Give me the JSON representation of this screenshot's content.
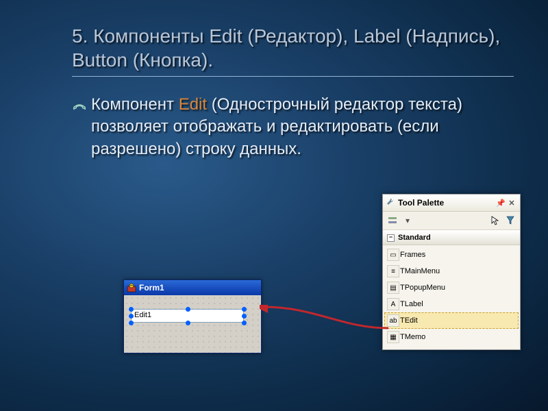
{
  "title": "5. Компоненты Edit (Редактор), Label (Надпись), Button (Кнопка).",
  "body": {
    "before": "Компонент ",
    "accent": "Edit",
    "after": " (Однострочный редактор текста) позволяет отображать и редактировать (если разрешено) строку данных."
  },
  "form": {
    "title": "Form1",
    "edit_value": "Edit1"
  },
  "palette": {
    "title": "Tool Palette",
    "category": "Standard",
    "items": [
      {
        "label": "Frames",
        "icon": "▭"
      },
      {
        "label": "TMainMenu",
        "icon": "≡"
      },
      {
        "label": "TPopupMenu",
        "icon": "▤"
      },
      {
        "label": "TLabel",
        "icon": "A"
      },
      {
        "label": "TEdit",
        "icon": "ab",
        "selected": true
      },
      {
        "label": "TMemo",
        "icon": "▦"
      }
    ]
  }
}
